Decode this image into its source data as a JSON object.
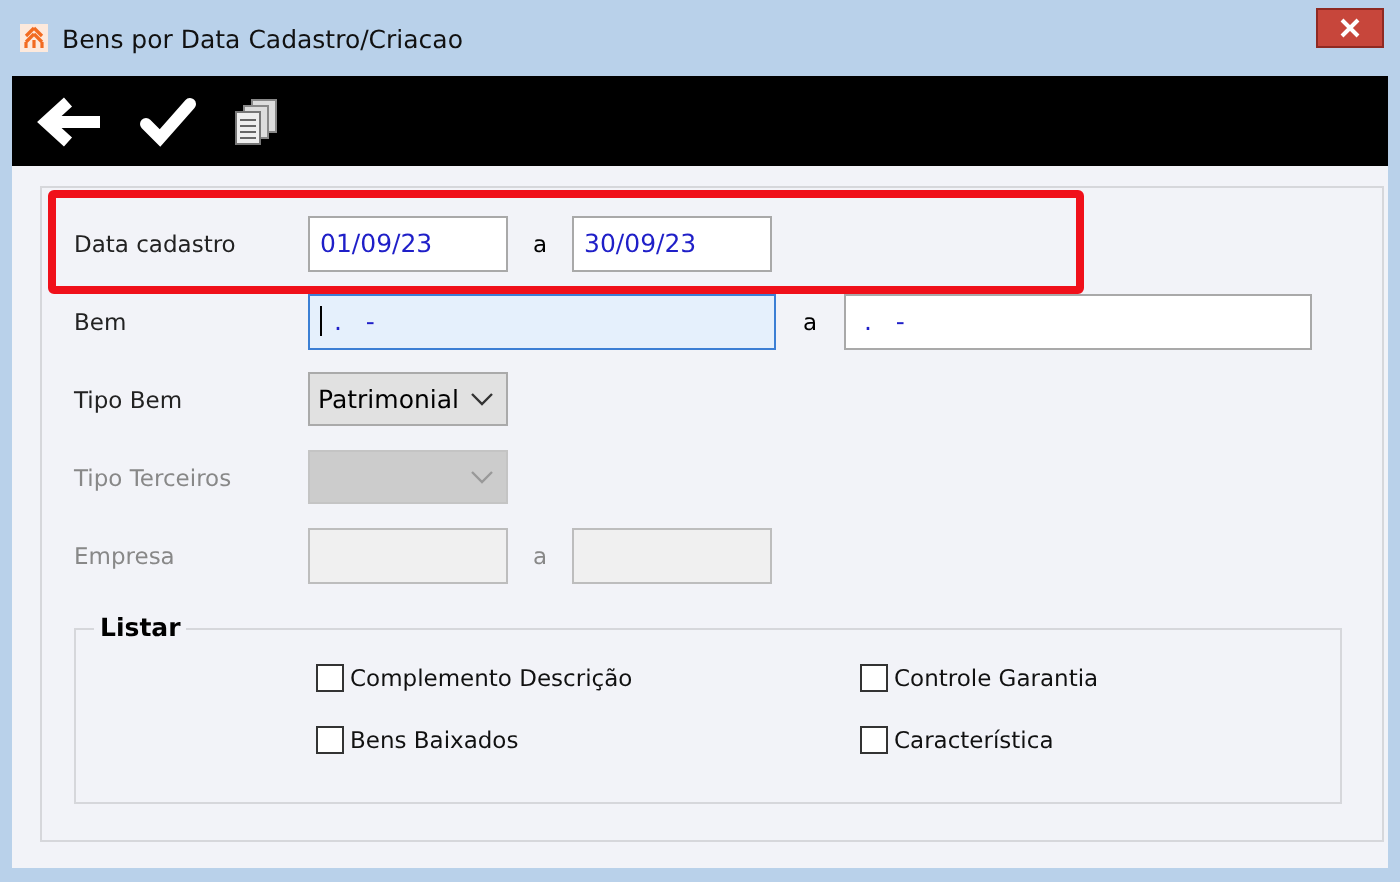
{
  "window": {
    "title": "Bens por Data Cadastro/Criacao"
  },
  "toolbar": [
    {
      "kind": "back"
    },
    {
      "kind": "confirm"
    },
    {
      "kind": "copy"
    }
  ],
  "rows": [
    {
      "kind": "range",
      "label": "Data cadastro",
      "disabled": false,
      "highlighted": true,
      "from": {
        "value": "01/09/23",
        "focused": false
      },
      "separator": "a",
      "to": {
        "value": "30/09/23",
        "focused": false
      },
      "wide": false
    },
    {
      "kind": "range",
      "label": "Bem",
      "disabled": false,
      "highlighted": false,
      "from": {
        "value": " .   -",
        "focused": true
      },
      "separator": "a",
      "to": {
        "value": " .   -",
        "focused": false
      },
      "wide": true
    },
    {
      "kind": "select",
      "label": "Tipo Bem",
      "disabled": false,
      "highlighted": false,
      "value": "Patrimonial"
    },
    {
      "kind": "select",
      "label": "Tipo Terceiros",
      "disabled": true,
      "highlighted": false
    },
    {
      "kind": "range",
      "label": "Empresa",
      "disabled": true,
      "highlighted": false,
      "from": {
        "focused": false
      },
      "separator": "a",
      "to": {
        "focused": false
      },
      "wide": false
    }
  ],
  "listar": {
    "title": "Listar",
    "options": [
      {
        "label": "Complemento Descrição",
        "checked": false
      },
      {
        "label": "Controle Garantia",
        "checked": false
      },
      {
        "label": "Bens Baixados",
        "checked": false
      },
      {
        "label": "Característica",
        "checked": false
      }
    ]
  }
}
